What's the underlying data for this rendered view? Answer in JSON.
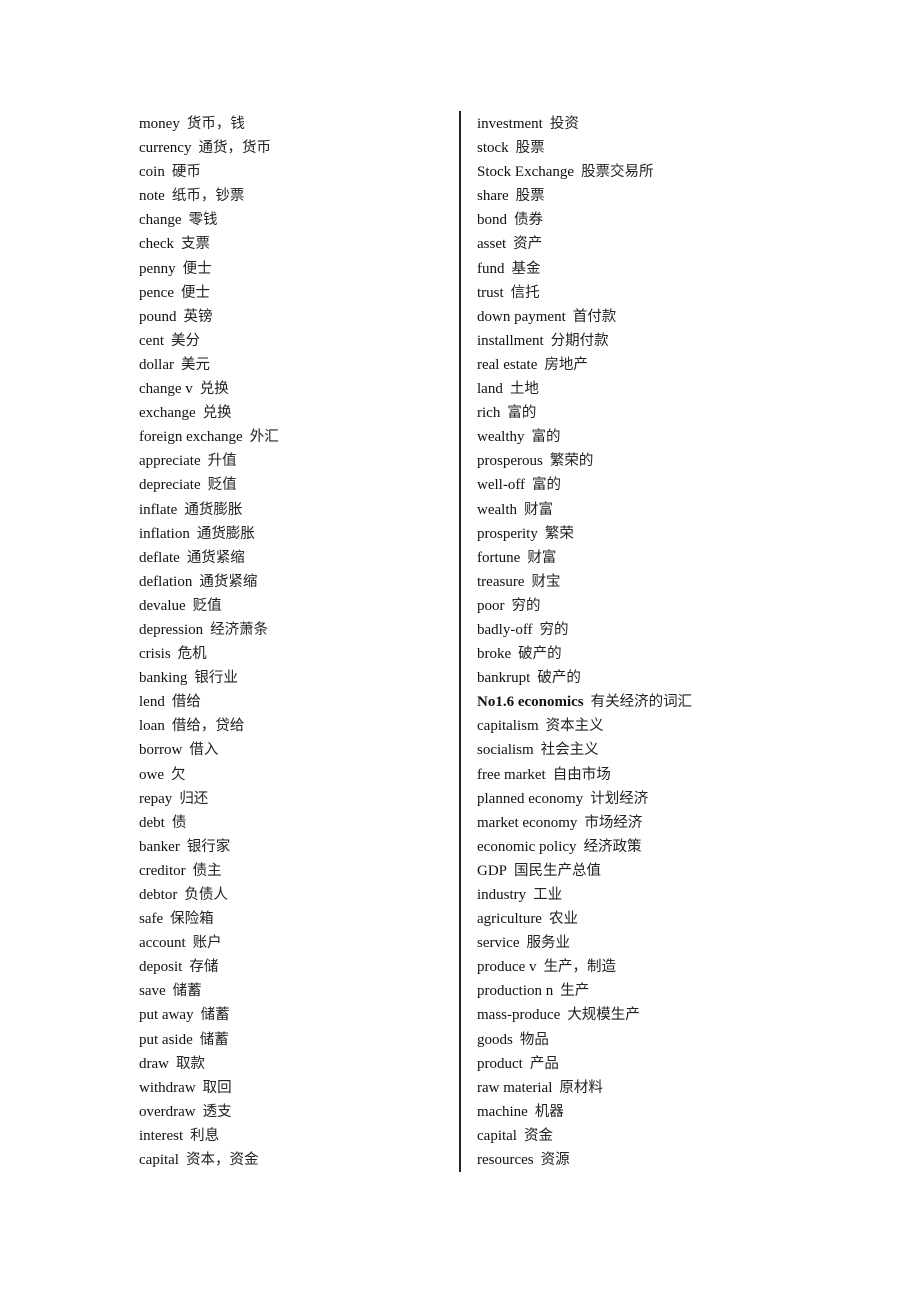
{
  "left_column": [
    {
      "en": "money",
      "zh": "货币，钱"
    },
    {
      "en": "currency",
      "zh": "通货，货币"
    },
    {
      "en": "coin",
      "zh": "硬币"
    },
    {
      "en": "note",
      "zh": "纸币，钞票"
    },
    {
      "en": "change",
      "zh": "零钱"
    },
    {
      "en": "check",
      "zh": "支票"
    },
    {
      "en": "penny",
      "zh": "便士"
    },
    {
      "en": "pence",
      "zh": "便士"
    },
    {
      "en": "pound",
      "zh": "英镑"
    },
    {
      "en": "cent",
      "zh": "美分"
    },
    {
      "en": "dollar",
      "zh": "美元"
    },
    {
      "en": "change v",
      "zh": "兑换"
    },
    {
      "en": "exchange",
      "zh": "兑换"
    },
    {
      "en": "foreign exchange",
      "zh": "外汇"
    },
    {
      "en": "appreciate",
      "zh": "升值"
    },
    {
      "en": "depreciate",
      "zh": "贬值"
    },
    {
      "en": "inflate",
      "zh": "通货膨胀"
    },
    {
      "en": "inflation",
      "zh": "通货膨胀"
    },
    {
      "en": "deflate",
      "zh": "通货紧缩"
    },
    {
      "en": "deflation",
      "zh": "通货紧缩"
    },
    {
      "en": "devalue",
      "zh": "贬值"
    },
    {
      "en": "depression",
      "zh": "经济萧条"
    },
    {
      "en": "crisis",
      "zh": "危机"
    },
    {
      "en": "banking",
      "zh": "银行业"
    },
    {
      "en": "lend",
      "zh": "借给"
    },
    {
      "en": "loan",
      "zh": "借给，贷给"
    },
    {
      "en": "borrow",
      "zh": "借入"
    },
    {
      "en": "owe",
      "zh": "欠"
    },
    {
      "en": "repay",
      "zh": "归还"
    },
    {
      "en": "debt",
      "zh": "债"
    },
    {
      "en": "banker",
      "zh": "银行家"
    },
    {
      "en": "creditor",
      "zh": "债主"
    },
    {
      "en": "debtor",
      "zh": "负债人"
    },
    {
      "en": "safe",
      "zh": "保险箱"
    },
    {
      "en": "account",
      "zh": "账户"
    },
    {
      "en": "deposit",
      "zh": "存储"
    },
    {
      "en": "save",
      "zh": "储蓄"
    },
    {
      "en": "put away",
      "zh": "储蓄"
    },
    {
      "en": "put aside",
      "zh": "储蓄"
    },
    {
      "en": "draw",
      "zh": "取款"
    },
    {
      "en": "withdraw",
      "zh": "取回"
    },
    {
      "en": "overdraw",
      "zh": "透支"
    },
    {
      "en": "interest",
      "zh": "利息"
    },
    {
      "en": "capital",
      "zh": "资本，资金"
    }
  ],
  "right_column": [
    {
      "en": "investment",
      "zh": "投资"
    },
    {
      "en": "stock",
      "zh": "股票"
    },
    {
      "en": "Stock Exchange",
      "zh": "股票交易所"
    },
    {
      "en": "share",
      "zh": "股票"
    },
    {
      "en": "bond",
      "zh": "债券"
    },
    {
      "en": "asset",
      "zh": "资产"
    },
    {
      "en": "fund",
      "zh": "基金"
    },
    {
      "en": "trust",
      "zh": "信托"
    },
    {
      "en": "down payment",
      "zh": "首付款"
    },
    {
      "en": "installment",
      "zh": "分期付款"
    },
    {
      "en": "real estate",
      "zh": "房地产"
    },
    {
      "en": "land",
      "zh": "土地"
    },
    {
      "en": "rich",
      "zh": "富的"
    },
    {
      "en": "wealthy",
      "zh": "富的"
    },
    {
      "en": "prosperous",
      "zh": "繁荣的"
    },
    {
      "en": "well-off",
      "zh": "富的"
    },
    {
      "en": "wealth",
      "zh": "财富"
    },
    {
      "en": "prosperity",
      "zh": "繁荣"
    },
    {
      "en": "fortune",
      "zh": "财富"
    },
    {
      "en": "treasure",
      "zh": "财宝"
    },
    {
      "en": "poor",
      "zh": "穷的"
    },
    {
      "en": "badly-off",
      "zh": "穷的"
    },
    {
      "en": "broke",
      "zh": "破产的"
    },
    {
      "en": "bankrupt",
      "zh": "破产的"
    },
    {
      "en": "No1.6 economics",
      "zh": "有关经济的词汇",
      "heading": true
    },
    {
      "en": "capitalism",
      "zh": "资本主义"
    },
    {
      "en": "socialism",
      "zh": "社会主义"
    },
    {
      "en": "free market",
      "zh": "自由市场"
    },
    {
      "en": "planned economy",
      "zh": "计划经济"
    },
    {
      "en": "market economy",
      "zh": "市场经济"
    },
    {
      "en": "economic policy",
      "zh": "经济政策"
    },
    {
      "en": "GDP",
      "zh": "国民生产总值"
    },
    {
      "en": "industry",
      "zh": "工业"
    },
    {
      "en": "agriculture",
      "zh": "农业"
    },
    {
      "en": "service",
      "zh": "服务业"
    },
    {
      "en": "produce v",
      "zh": "生产，制造"
    },
    {
      "en": "production n",
      "zh": "生产"
    },
    {
      "en": "mass-produce",
      "zh": "大规模生产"
    },
    {
      "en": "goods",
      "zh": "物品"
    },
    {
      "en": "product",
      "zh": "产品"
    },
    {
      "en": "raw material",
      "zh": "原材料"
    },
    {
      "en": "machine",
      "zh": "机器"
    },
    {
      "en": "capital",
      "zh": "资金"
    },
    {
      "en": "resources",
      "zh": "资源"
    }
  ]
}
